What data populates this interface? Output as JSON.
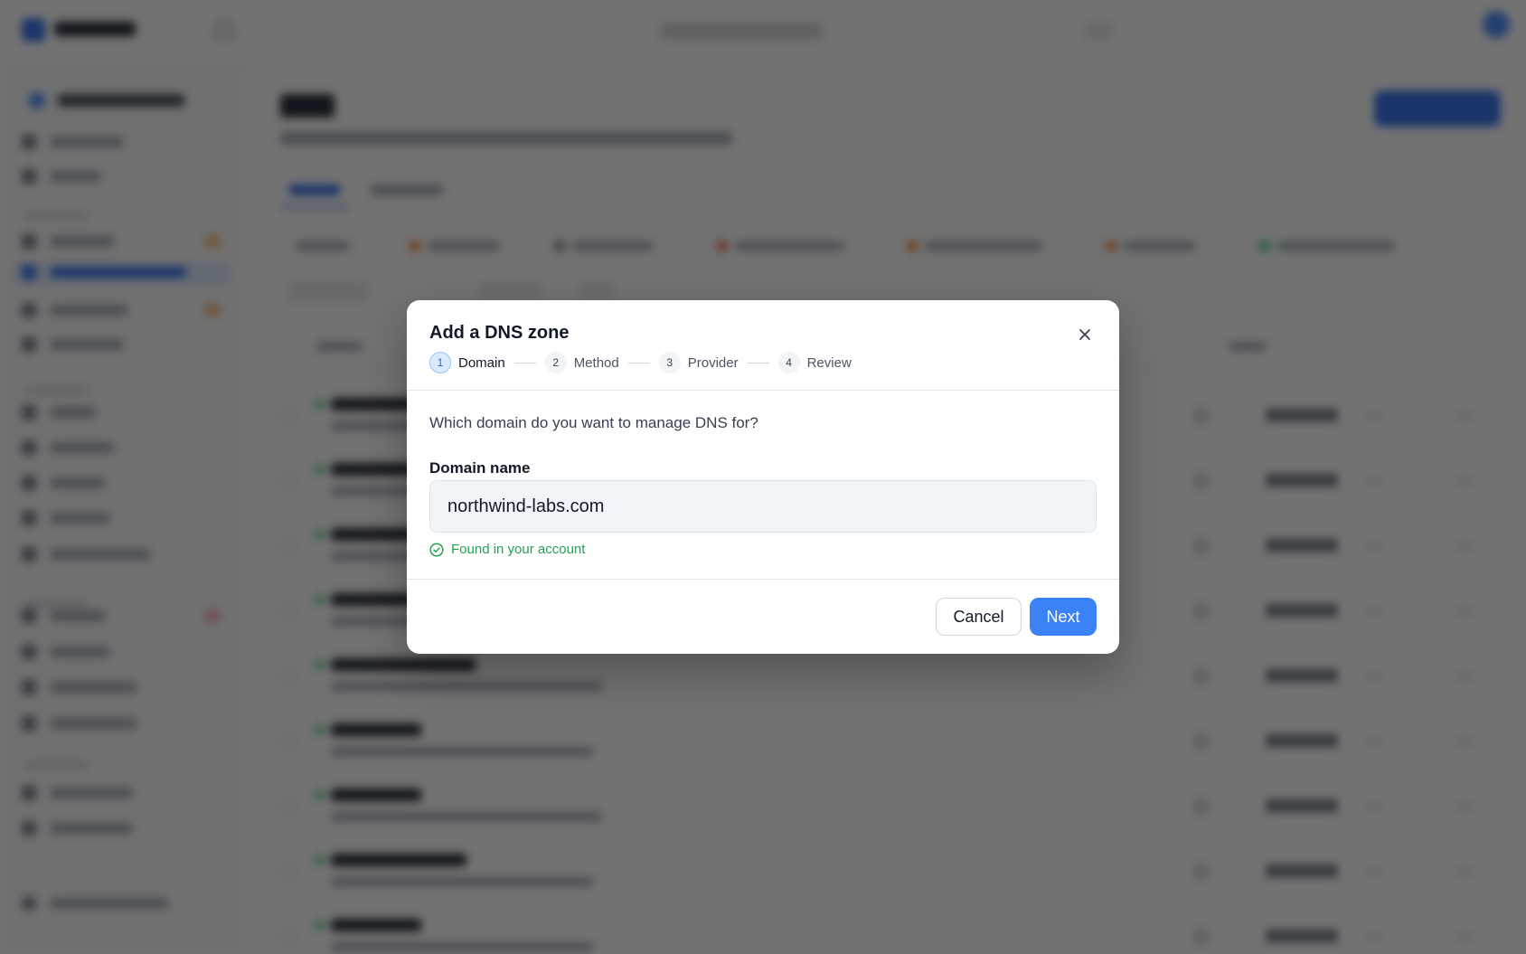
{
  "modal": {
    "title": "Add a DNS zone",
    "steps": [
      {
        "number": "1",
        "label": "Domain",
        "active": true
      },
      {
        "number": "2",
        "label": "Method",
        "active": false
      },
      {
        "number": "3",
        "label": "Provider",
        "active": false
      },
      {
        "number": "4",
        "label": "Review",
        "active": false
      }
    ],
    "question": "Which domain do you want to manage DNS for?",
    "domain_field": {
      "label": "Domain name",
      "value": "northwind-labs.com"
    },
    "status": {
      "text": "Found in your account",
      "icon": "check-circle-icon",
      "color": "#22a155"
    },
    "buttons": {
      "cancel": "Cancel",
      "next": "Next"
    },
    "close_icon": "close-icon"
  },
  "colors": {
    "accent": "#3b82f6",
    "overlay": "rgba(20,20,20,0.6)"
  }
}
